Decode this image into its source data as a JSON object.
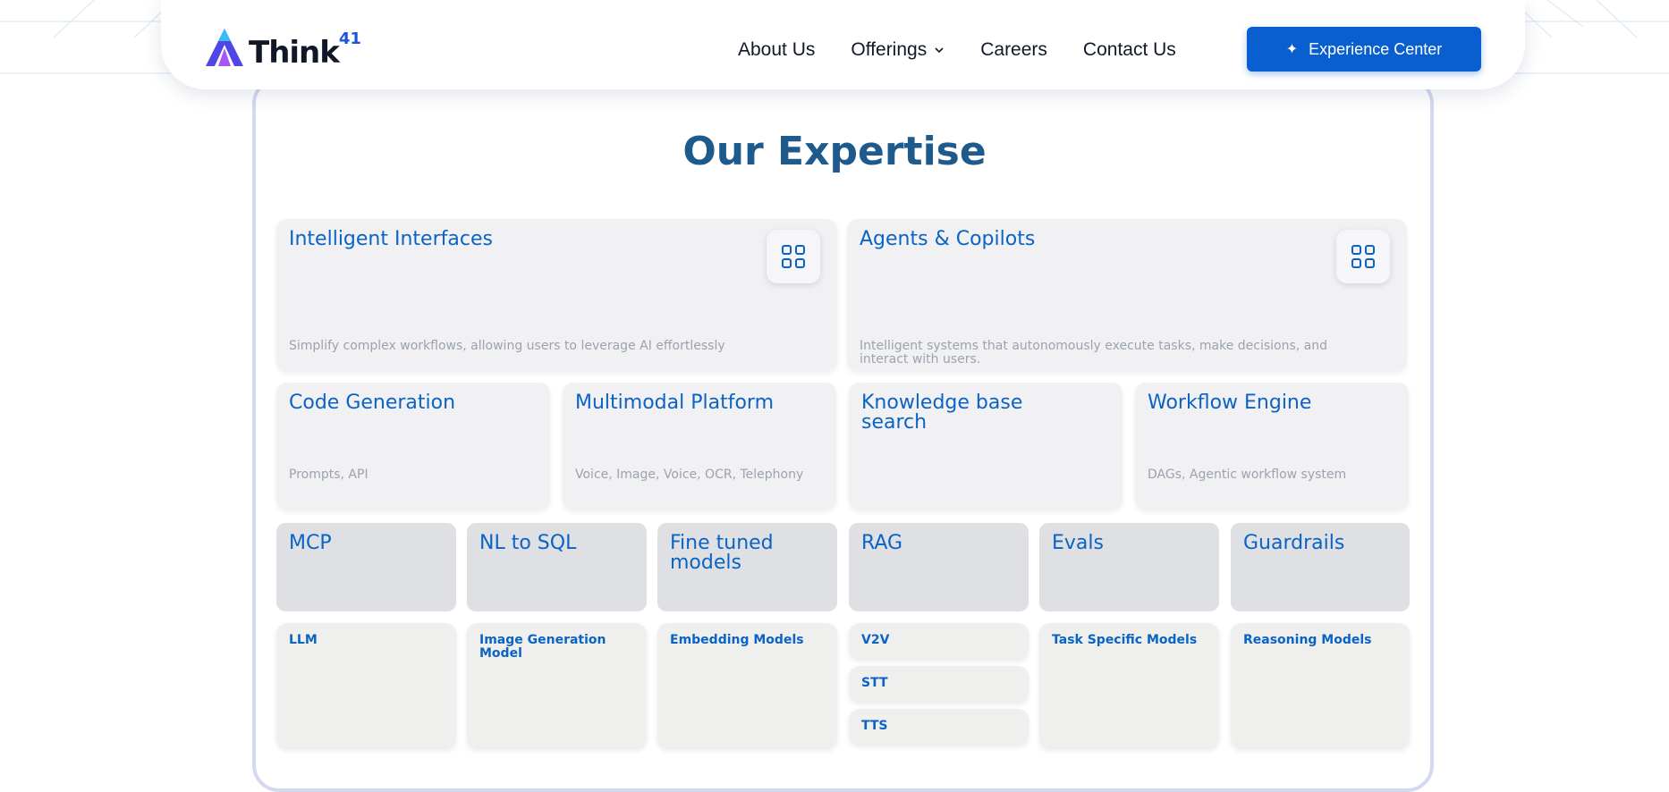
{
  "header": {
    "logo_text": "Think",
    "logo_sup": "41",
    "nav": [
      {
        "label": "About Us"
      },
      {
        "label": "Offerings"
      },
      {
        "label": "Careers"
      },
      {
        "label": "Contact Us"
      }
    ],
    "cta_label": "Experience Center"
  },
  "main": {
    "title": "Our Expertise",
    "feature_cards": [
      {
        "title": "Intelligent Interfaces",
        "desc": "Simplify complex workflows, allowing users to leverage AI effortlessly",
        "icon": "grid-icon"
      },
      {
        "title": "Agents & Copilots",
        "desc": "Intelligent systems that autonomously execute tasks, make decisions, and interact with users.",
        "icon": "grid-icon"
      }
    ],
    "service_cards": [
      {
        "title": "Code Generation",
        "desc": "Prompts, API"
      },
      {
        "title": "Multimodal Platform",
        "desc": "Voice, Image, Voice, OCR, Telephony"
      },
      {
        "title": "Knowledge base search",
        "desc": ""
      },
      {
        "title": "Workflow Engine",
        "desc": "DAGs, Agentic workflow system"
      }
    ],
    "capability_tiles": [
      {
        "title": "MCP"
      },
      {
        "title": "NL to SQL"
      },
      {
        "title": "Fine tuned models"
      },
      {
        "title": "RAG"
      },
      {
        "title": "Evals"
      },
      {
        "title": "Guardrails"
      }
    ],
    "model_types": [
      {
        "label": "LLM"
      },
      {
        "label": "Image Generation Model"
      },
      {
        "label": "Embedding Models"
      },
      {
        "label": "V2V"
      },
      {
        "label": "STT"
      },
      {
        "label": "TTS"
      },
      {
        "label": "Task Specific Models"
      },
      {
        "label": "Reasoning Models"
      }
    ]
  },
  "colors": {
    "accent": "#0a5fd0",
    "title": "#1e5a8c",
    "card_title": "#0b63c4",
    "panel_border": "#d4d9ef"
  }
}
